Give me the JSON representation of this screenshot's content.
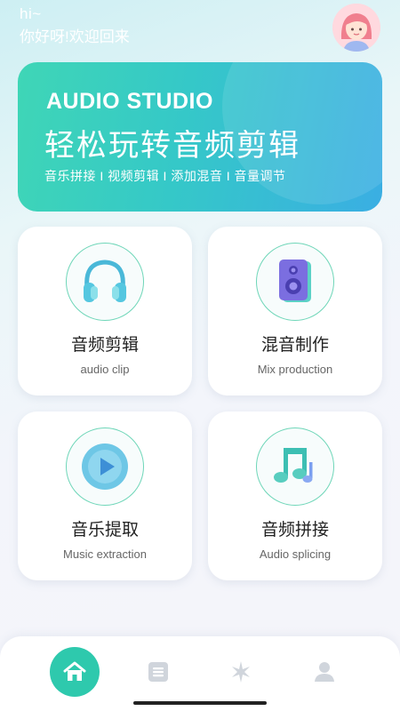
{
  "header": {
    "greeting_small": "hi~",
    "greeting": "你好呀!欢迎回来"
  },
  "banner": {
    "title": "AUDIO STUDIO",
    "subtitle": "轻松玩转音频剪辑",
    "tags": "音乐拼接 I 视频剪辑 I 添加混音 I 音量调节"
  },
  "features": [
    {
      "label_cn": "音频剪辑",
      "label_en": "audio clip",
      "icon": "headphones-icon"
    },
    {
      "label_cn": "混音制作",
      "label_en": "Mix production",
      "icon": "speaker-icon"
    },
    {
      "label_cn": "音乐提取",
      "label_en": "Music extraction",
      "icon": "play-icon"
    },
    {
      "label_cn": "音频拼接",
      "label_en": "Audio splicing",
      "icon": "music-notes-icon"
    }
  ],
  "nav": {
    "items": [
      "home-icon",
      "list-icon",
      "sparkle-icon",
      "profile-icon"
    ],
    "active": 0
  },
  "colors": {
    "accent": "#2ec9ad",
    "banner_start": "#3fd6b6",
    "banner_end": "#3aaee3",
    "nav_inactive": "#d0d5dc"
  }
}
